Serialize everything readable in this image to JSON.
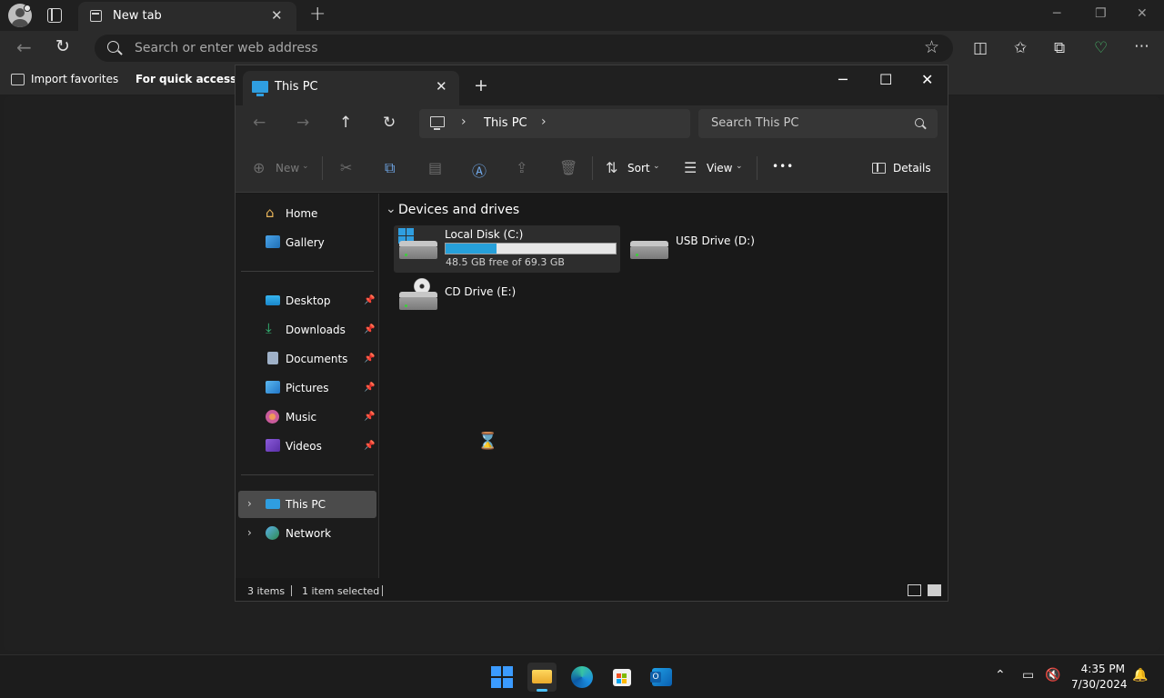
{
  "browser": {
    "tab_title": "New tab",
    "tab_close": "✕",
    "new_tab": "+",
    "win_minimize": "─",
    "win_restore": "❐",
    "win_close": "✕",
    "address_placeholder": "Search or enter web address",
    "favorites": {
      "import_label": "Import favorites",
      "quick_access_label": "For quick access, pla"
    }
  },
  "explorer": {
    "tab_title": "This PC",
    "breadcrumb": {
      "item": "This PC"
    },
    "search_placeholder": "Search This PC",
    "commands": {
      "new_label": "New",
      "sort_label": "Sort",
      "view_label": "View",
      "more_label": "•••",
      "details_label": "Details"
    },
    "sidebar": {
      "quick": [
        {
          "label": "Home",
          "icon": "home-icon"
        },
        {
          "label": "Gallery",
          "icon": "gallery-icon"
        }
      ],
      "pinned": [
        {
          "label": "Desktop",
          "icon": "desktop-icon"
        },
        {
          "label": "Downloads",
          "icon": "downloads-icon"
        },
        {
          "label": "Documents",
          "icon": "documents-icon"
        },
        {
          "label": "Pictures",
          "icon": "pictures-icon"
        },
        {
          "label": "Music",
          "icon": "music-icon"
        },
        {
          "label": "Videos",
          "icon": "videos-icon"
        }
      ],
      "roots": [
        {
          "label": "This PC",
          "icon": "this-pc-icon",
          "selected": true
        },
        {
          "label": "Network",
          "icon": "network-icon",
          "selected": false
        }
      ]
    },
    "main": {
      "group_title": "Devices and drives",
      "drives": [
        {
          "name": "Local Disk (C:)",
          "free_text": "48.5 GB free of 69.3 GB",
          "used_fraction": 0.3,
          "selected": true
        },
        {
          "name": "USB Drive (D:)",
          "selected": false
        },
        {
          "name": "CD Drive (E:)",
          "selected": false
        }
      ]
    },
    "status": {
      "items": "3 items",
      "selected": "1 item selected"
    }
  },
  "taskbar": {
    "time": "4:35 PM",
    "date": "7/30/2024",
    "apps": [
      "start-icon",
      "file-explorer-icon",
      "edge-icon",
      "store-icon",
      "outlook-icon"
    ]
  },
  "colors": {
    "accent": "#26a0da",
    "windows_blue": "#2f9ee0",
    "taskbar_indicator": "#4cc2ff"
  }
}
